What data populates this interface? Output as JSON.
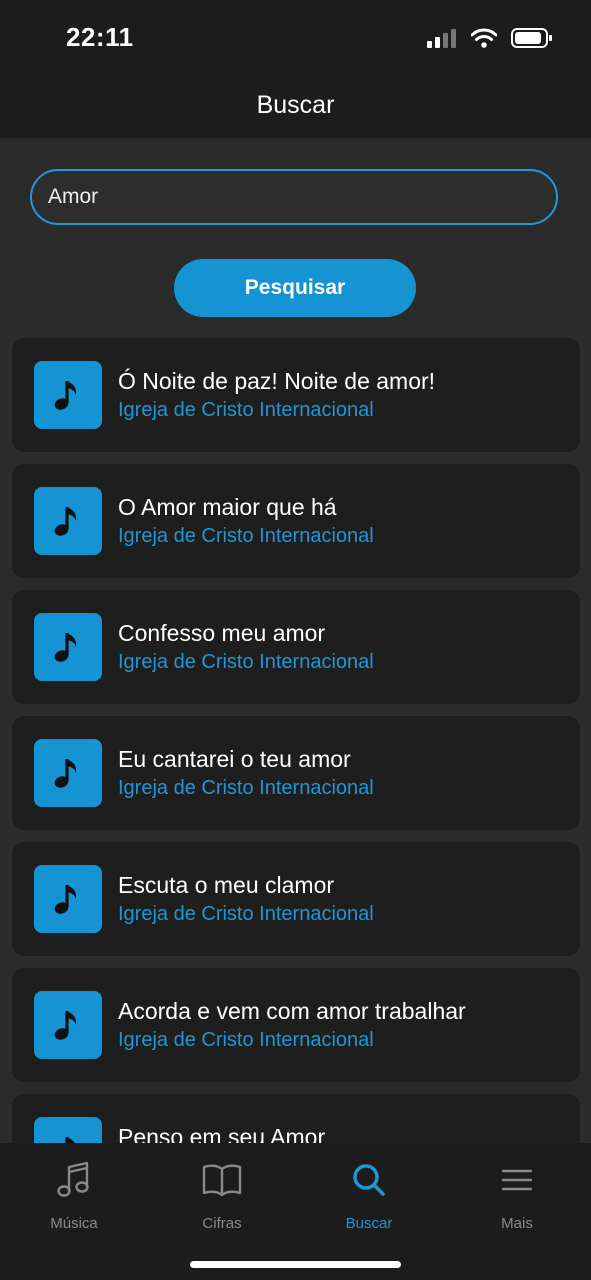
{
  "status": {
    "time": "22:11"
  },
  "header": {
    "title": "Buscar"
  },
  "search": {
    "value": "Amor",
    "button_label": "Pesquisar"
  },
  "results": [
    {
      "title": "Ó Noite de paz! Noite de amor!",
      "artist": "Igreja de Cristo Internacional"
    },
    {
      "title": "O Amor maior que há",
      "artist": "Igreja de Cristo Internacional"
    },
    {
      "title": "Confesso meu amor",
      "artist": "Igreja de Cristo Internacional"
    },
    {
      "title": "Eu cantarei o teu amor",
      "artist": "Igreja de Cristo Internacional"
    },
    {
      "title": "Escuta o meu clamor",
      "artist": "Igreja de Cristo Internacional"
    },
    {
      "title": "Acorda e vem com amor trabalhar",
      "artist": "Igreja de Cristo Internacional"
    },
    {
      "title": "Penso em seu Amor",
      "artist": ""
    }
  ],
  "tabs": [
    {
      "label": "Música",
      "icon": "music-note-icon",
      "active": false
    },
    {
      "label": "Cifras",
      "icon": "book-icon",
      "active": false
    },
    {
      "label": "Buscar",
      "icon": "search-icon",
      "active": true
    },
    {
      "label": "Mais",
      "icon": "menu-icon",
      "active": false
    }
  ],
  "colors": {
    "accent": "#1693d3",
    "background": "#2b2b2b",
    "card": "#1e1e1e",
    "bar": "#1c1c1c"
  }
}
